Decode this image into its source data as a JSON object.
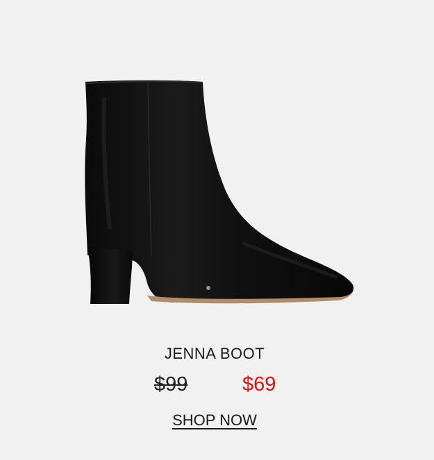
{
  "product": {
    "name": "JENNA BOOT",
    "original_price": "$99",
    "sale_price": "$69",
    "cta_label": "SHOP NOW",
    "image_icon": "black-ankle-boot",
    "colors": {
      "background": "#f1f1f1",
      "text": "#1a1a1a",
      "sale_price": "#e0120f",
      "boot": "#111111"
    }
  }
}
